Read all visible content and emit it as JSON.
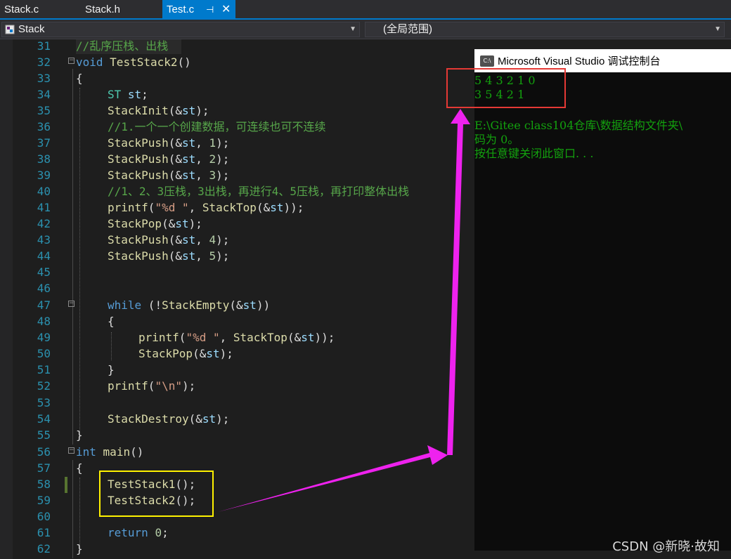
{
  "tabs": [
    {
      "label": "Stack.c",
      "active": false
    },
    {
      "label": "Stack.h",
      "active": false
    },
    {
      "label": "Test.c",
      "active": true
    }
  ],
  "tab_pin_icon": "pin-icon",
  "tab_close_icon": "close-icon",
  "navbar": {
    "scope_combo": "Stack",
    "member_combo": "(全局范围)"
  },
  "code_lines": [
    {
      "n": "31",
      "text": "//乱序压栈、出栈"
    },
    {
      "n": "32",
      "text": "void TestStack2()"
    },
    {
      "n": "33",
      "text": "{"
    },
    {
      "n": "34",
      "text": "ST st;"
    },
    {
      "n": "35",
      "text": "StackInit(&st);"
    },
    {
      "n": "36",
      "text": "//1.一个一个创建数据，可连续也可不连续"
    },
    {
      "n": "37",
      "text": "StackPush(&st, 1);"
    },
    {
      "n": "38",
      "text": "StackPush(&st, 2);"
    },
    {
      "n": "39",
      "text": "StackPush(&st, 3);"
    },
    {
      "n": "40",
      "text": "//1、2、3压栈，3出栈，再进行4、5压栈，再打印整体出栈"
    },
    {
      "n": "41",
      "text": "printf(\"%d \", StackTop(&st));"
    },
    {
      "n": "42",
      "text": "StackPop(&st);"
    },
    {
      "n": "43",
      "text": "StackPush(&st, 4);"
    },
    {
      "n": "44",
      "text": "StackPush(&st, 5);"
    },
    {
      "n": "45",
      "text": ""
    },
    {
      "n": "46",
      "text": ""
    },
    {
      "n": "47",
      "text": "while (!StackEmpty(&st))"
    },
    {
      "n": "48",
      "text": "{"
    },
    {
      "n": "49",
      "text": "printf(\"%d \", StackTop(&st));"
    },
    {
      "n": "50",
      "text": "StackPop(&st);"
    },
    {
      "n": "51",
      "text": "}"
    },
    {
      "n": "52",
      "text": "printf(\"\\n\");"
    },
    {
      "n": "53",
      "text": ""
    },
    {
      "n": "54",
      "text": "StackDestroy(&st);"
    },
    {
      "n": "55",
      "text": "}"
    },
    {
      "n": "56",
      "text": "int main()"
    },
    {
      "n": "57",
      "text": "{"
    },
    {
      "n": "58",
      "text": "TestStack1();"
    },
    {
      "n": "59",
      "text": "TestStack2();"
    },
    {
      "n": "60",
      "text": ""
    },
    {
      "n": "61",
      "text": "return 0;"
    },
    {
      "n": "62",
      "text": "}"
    }
  ],
  "console": {
    "title": "Microsoft Visual Studio 调试控制台",
    "title_icon": "console-app-icon",
    "lines": [
      "5 4 3 2 1 0",
      "3 5 4 2 1",
      "",
      "E:\\Gitee class104仓库\\数据结构文件夹\\",
      "码为 0。",
      "按任意键关闭此窗口. . ."
    ]
  },
  "annotations": {
    "output_box_color": "#e53935",
    "calls_box_color": "#fff200",
    "arrow_color": "#ee22ee"
  },
  "watermark": "CSDN @新晓·故知",
  "colors": {
    "editor_bg": "#1e1e1e",
    "tab_active": "#007acc",
    "console_text": "#13a10e"
  }
}
